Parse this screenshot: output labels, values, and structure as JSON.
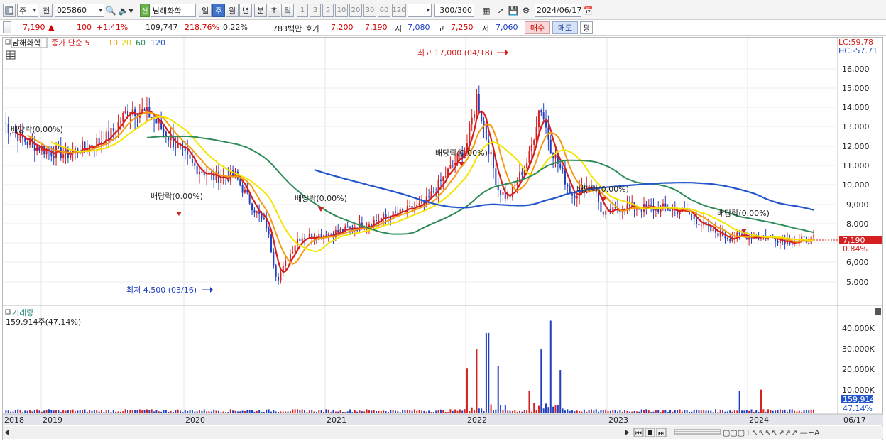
{
  "toolbar": {
    "period_select": "주",
    "prev_label": "전",
    "code": "025860",
    "stock_badge": "신",
    "stock_name": "남해화학",
    "periods": [
      "일",
      "주",
      "월",
      "년",
      "분",
      "초",
      "틱"
    ],
    "active_period": "주",
    "intervals": [
      "1",
      "3",
      "5",
      "10",
      "20",
      "30",
      "60",
      "120"
    ],
    "count_value": "300",
    "count_total": "/300",
    "date": "2024/06/17"
  },
  "quote": {
    "price": "7,190",
    "change_arrow": "▲",
    "change": "100",
    "change_pct": "+1.41%",
    "volume": "109,747",
    "volume_ratio": "218.76%",
    "turnover": "0.22%",
    "amount": "783백만",
    "ask_label": "호가",
    "ask1": "7,200",
    "ask2": "7,190",
    "open_label": "시",
    "open": "7,080",
    "high_label": "고",
    "high": "7,250",
    "low_label": "저",
    "low": "7,060",
    "buy_button": "매수",
    "sell_button": "매도",
    "eval_button": "평"
  },
  "price_panel": {
    "stock_label": "남해화학",
    "legend_prefix": "종가 단순 5",
    "ma_legend": [
      {
        "label": "10",
        "color": "#f39c12"
      },
      {
        "label": "20",
        "color": "#f2e600"
      },
      {
        "label": "60",
        "color": "#2e8b57"
      },
      {
        "label": "120",
        "color": "#2255cc"
      }
    ],
    "lc": "LC:59.78",
    "hc": "HC:-57.71",
    "current_price_tag": "7,190",
    "current_pct_tag": "0.84%",
    "high_annotation": "최고 17,000 (04/18)",
    "low_annotation": "최저 4,500 (03/16)",
    "dividend_labels": [
      "배당락(0.00%)",
      "배당락(0.00%)",
      "배당락(0.00%)",
      "배당락(0.00%)",
      "배당락(0.00%)",
      "배당락(0.00%)"
    ]
  },
  "volume_panel": {
    "title": "거래량",
    "current": "159,914주(47.14%)",
    "tag_value": "159,914",
    "tag_pct": "47.14%"
  },
  "date_bar": {
    "end_label": "06/17"
  },
  "chart_data": [
    {
      "type": "candlestick",
      "title": "남해화학",
      "y_ticks": [
        "5,000",
        "6,000",
        "7,000",
        "8,000",
        "9,000",
        "10,000",
        "11,000",
        "12,000",
        "13,000",
        "14,000",
        "15,000",
        "16,000"
      ],
      "ylim": [
        4000,
        17500
      ],
      "x_ticks": [
        "2018",
        "2019",
        "2020",
        "2021",
        "2022",
        "2023",
        "2024"
      ],
      "close_series": [
        [
          "2018-01",
          13200
        ],
        [
          "2018-03",
          12300
        ],
        [
          "2018-05",
          11800
        ],
        [
          "2018-07",
          11600
        ],
        [
          "2018-09",
          12000
        ],
        [
          "2018-11",
          12500
        ],
        [
          "2019-01",
          14000
        ],
        [
          "2019-03",
          13600
        ],
        [
          "2019-05",
          12300
        ],
        [
          "2019-07",
          11000
        ],
        [
          "2019-09",
          10400
        ],
        [
          "2019-11",
          10500
        ],
        [
          "2020-01",
          8600
        ],
        [
          "2020-02",
          7900
        ],
        [
          "2020-03",
          5100
        ],
        [
          "2020-05",
          7300
        ],
        [
          "2020-07",
          7400
        ],
        [
          "2020-09",
          7600
        ],
        [
          "2020-11",
          7900
        ],
        [
          "2021-01",
          8300
        ],
        [
          "2021-03",
          8600
        ],
        [
          "2021-05",
          9000
        ],
        [
          "2021-07",
          10500
        ],
        [
          "2021-09",
          12000
        ],
        [
          "2021-10",
          14600
        ],
        [
          "2021-12",
          9800
        ],
        [
          "2022-01",
          9300
        ],
        [
          "2022-03",
          11500
        ],
        [
          "2022-04",
          14200
        ],
        [
          "2022-05",
          12000
        ],
        [
          "2022-07",
          9500
        ],
        [
          "2022-09",
          10100
        ],
        [
          "2022-10",
          8400
        ],
        [
          "2022-12",
          8900
        ],
        [
          "2023-02",
          8800
        ],
        [
          "2023-04",
          8800
        ],
        [
          "2023-06",
          8600
        ],
        [
          "2023-08",
          7700
        ],
        [
          "2023-10",
          7300
        ],
        [
          "2023-12",
          7400
        ],
        [
          "2024-02",
          7300
        ],
        [
          "2024-04",
          7100
        ],
        [
          "2024-06",
          7190
        ]
      ],
      "annotations": [
        {
          "text": "최고 17,000 (04/18)",
          "value": 17000
        },
        {
          "text": "최저 4,500 (03/16)",
          "value": 4500
        }
      ],
      "moving_averages": [
        "5",
        "10",
        "20",
        "60",
        "120"
      ]
    },
    {
      "type": "bar",
      "title": "거래량",
      "y_ticks": [
        "10,000K",
        "20,000K",
        "30,000K",
        "40,000K"
      ],
      "ylim": [
        0,
        47000
      ],
      "peaks_k": [
        [
          "2021-09",
          22000
        ],
        [
          "2021-10",
          31000
        ],
        [
          "2021-11",
          39000
        ],
        [
          "2021-12",
          23000
        ],
        [
          "2022-03",
          11000
        ],
        [
          "2022-04",
          31000
        ],
        [
          "2022-05",
          45000
        ],
        [
          "2022-06",
          21000
        ],
        [
          "2023-11",
          11000
        ],
        [
          "2024-01",
          11500
        ]
      ],
      "current": 159914
    }
  ]
}
